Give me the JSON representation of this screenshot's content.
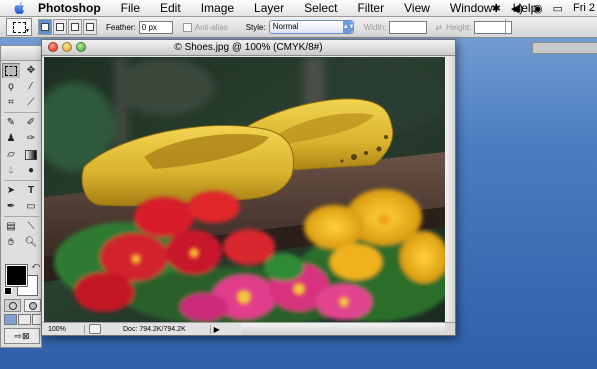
{
  "menubar": {
    "app_name": "Photoshop",
    "items": [
      "File",
      "Edit",
      "Image",
      "Layer",
      "Select",
      "Filter",
      "View",
      "Window",
      "Help"
    ],
    "clock": "Fri 2"
  },
  "options": {
    "feather_label": "Feather:",
    "feather_value": "0 px",
    "antialias_label": "Anti-alias",
    "style_label": "Style:",
    "style_value": "Normal",
    "width_label": "Width:",
    "height_label": "Height:"
  },
  "document": {
    "title": "© Shoes.jpg @ 100% (CMYK/8#)",
    "zoom": "100%",
    "doc_info": "Doc: 794.2K/794.2K"
  },
  "colors": {
    "foreground": "#000000",
    "background": "#ffffff",
    "desktop": "#3f6fb6",
    "selection_accent": "#6d9bdc"
  },
  "photo": {
    "subject": "yellow wooden clogs with red and pink primroses"
  }
}
